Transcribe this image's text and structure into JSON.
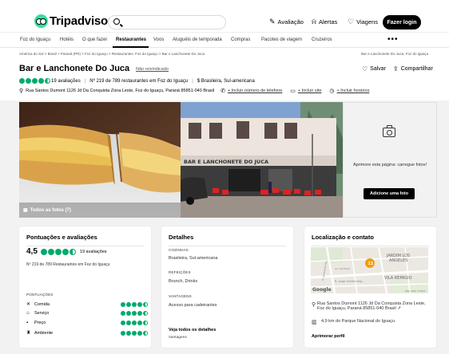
{
  "header": {
    "logo_text": "Tripadvisor",
    "search_placeholder": "",
    "nav": [
      {
        "icon": "pencil-icon",
        "glyph": "✎",
        "label": "Avaliação"
      },
      {
        "icon": "bell-icon",
        "glyph": "🔔",
        "label": "Alertas"
      },
      {
        "icon": "heart-icon",
        "glyph": "♡",
        "label": "Viagens"
      }
    ],
    "login_label": "Fazer login"
  },
  "catnav": {
    "items": [
      "Foz do Iguaçu",
      "Hotéis",
      "O que fazer",
      "Restaurantes",
      "Voos",
      "Aluguéis de temporada",
      "Compras",
      "Pacotes de viagem",
      "Cruzeiros"
    ],
    "active": "Restaurantes",
    "more": "•••"
  },
  "breadcrumb": {
    "left": "América do Sul  >  Brasil  >  Paraná (PR)  >  Foz do Iguaçu  >  Restaurantes: Foz do Iguaçu  >  Bar e Lanchonete Do Juca",
    "right": "Bar e Lanchonete Do Juca, Foz do Iguaçu"
  },
  "listing": {
    "name": "Bar e Lanchonete Do Juca",
    "claim": "Não reivindicado",
    "save_label": "Salvar",
    "share_label": "Compartilhar",
    "rating": 4.5,
    "reviews": "19 avaliações",
    "rank": "Nº 219 de 789 restaurantes em Foz do Iguaçu",
    "price_cuisine": "$  Brasileira, Sul-americana",
    "address": "Rua Santos Dumont 1126 Jd Da Conquista Zona Leste, Foz do Iguaçu, Paraná 85851-040 Brasil",
    "add_phone": "+ Incluir número de telefone",
    "add_site": "+ Incluir site",
    "add_hours": "+ Incluir horários"
  },
  "photos": {
    "all_label": "Todos as fotos (7)",
    "storefront_sign": "BAR E LANCHONETE DO JUCA",
    "panel_text": "Aprimore esta página: carregue fotos!",
    "add_photo_label": "Adicione uma foto"
  },
  "ratings_card": {
    "title": "Pontuações e avaliações",
    "score": "4,5",
    "reviews": "19 avaliações",
    "rank": "Nº 219 de 789 Restaurantes em Foz do Iguaçu",
    "section_label": "PONTUAÇÕES",
    "subratings": [
      {
        "label": "Comida",
        "icon": "food-icon",
        "glyph": "✕",
        "value": 4.5
      },
      {
        "label": "Serviço",
        "icon": "service-icon",
        "glyph": "⌂",
        "value": 4.5
      },
      {
        "label": "Preço",
        "icon": "price-icon",
        "glyph": "▪",
        "value": 4.5
      },
      {
        "label": "Ambiente",
        "icon": "ambience-icon",
        "glyph": "♜",
        "value": 4.5
      }
    ]
  },
  "details_card": {
    "title": "Detalhes",
    "cuisines_label": "COZINHAS",
    "cuisines": "Brasileira, Sul-americana",
    "meals_label": "REFEIÇÕES",
    "meals": "Brunch, Drinks",
    "advantages_label": "VANTAGENS",
    "advantages": "Acesso para cadeirantes",
    "see_all": "Veja todos os detalhes",
    "see_all_sub": "Vantagens"
  },
  "location_card": {
    "title": "Localização e contato",
    "map_labels": [
      "JARDIM LOS",
      "ANGELES",
      "VILA REMIGIO",
      "R. Jorge Schimmelp...",
      "Av. Garibaldi",
      "R. Jacarandá Açu"
    ],
    "map_pin": "11",
    "map_brand": "Google",
    "map_credit": "Map data ©2023",
    "address": "Rua Santos Dumont 1126 Jd Da Conquista Zona Leste, Foz do Iguaçu, Paraná 85851-040 Brasil ↗",
    "distance": "4,9 km do Parque Nacional do Iguaçu",
    "improve": "Aprimorar perfil"
  },
  "colors": {
    "accent": "#34e0a1",
    "bubble": "#00aa6c"
  }
}
